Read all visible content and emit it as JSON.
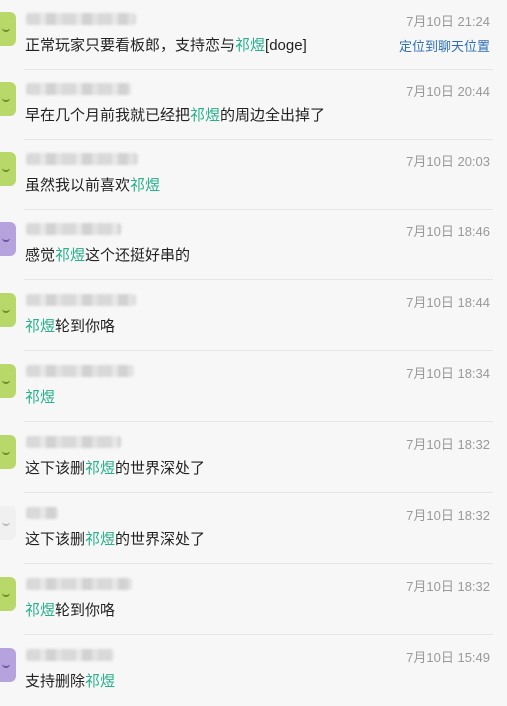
{
  "results": [
    {
      "time": "7月10日 21:24",
      "avatar": "green",
      "parts": [
        "正常玩家只要看板郎，支持恋与",
        "祁煜",
        "[doge]"
      ],
      "jump": "定位到聊天位置"
    },
    {
      "time": "7月10日 20:44",
      "avatar": "green",
      "parts": [
        "早在几个月前我就已经把",
        "祁煜",
        "的周边全出掉了"
      ]
    },
    {
      "time": "7月10日 20:03",
      "avatar": "green",
      "parts": [
        "虽然我以前喜欢",
        "祁煜",
        ""
      ]
    },
    {
      "time": "7月10日 18:46",
      "avatar": "purple",
      "parts": [
        "感觉",
        "祁煜",
        "这个还挺好串的"
      ]
    },
    {
      "time": "7月10日 18:44",
      "avatar": "green",
      "parts": [
        "",
        "祁煜",
        "轮到你咯"
      ]
    },
    {
      "time": "7月10日 18:34",
      "avatar": "green",
      "parts": [
        "",
        "祁煜",
        ""
      ]
    },
    {
      "time": "7月10日 18:32",
      "avatar": "green",
      "parts": [
        "这下该删",
        "祁煜",
        "的世界深处了"
      ]
    },
    {
      "time": "7月10日 18:32",
      "avatar": "white",
      "parts": [
        "这下该删",
        "祁煜",
        "的世界深处了"
      ]
    },
    {
      "time": "7月10日 18:32",
      "avatar": "green",
      "parts": [
        "",
        "祁煜",
        "轮到你咯"
      ]
    },
    {
      "time": "7月10日 15:49",
      "avatar": "purple",
      "parts": [
        "支持删除",
        "祁煜",
        ""
      ]
    }
  ]
}
